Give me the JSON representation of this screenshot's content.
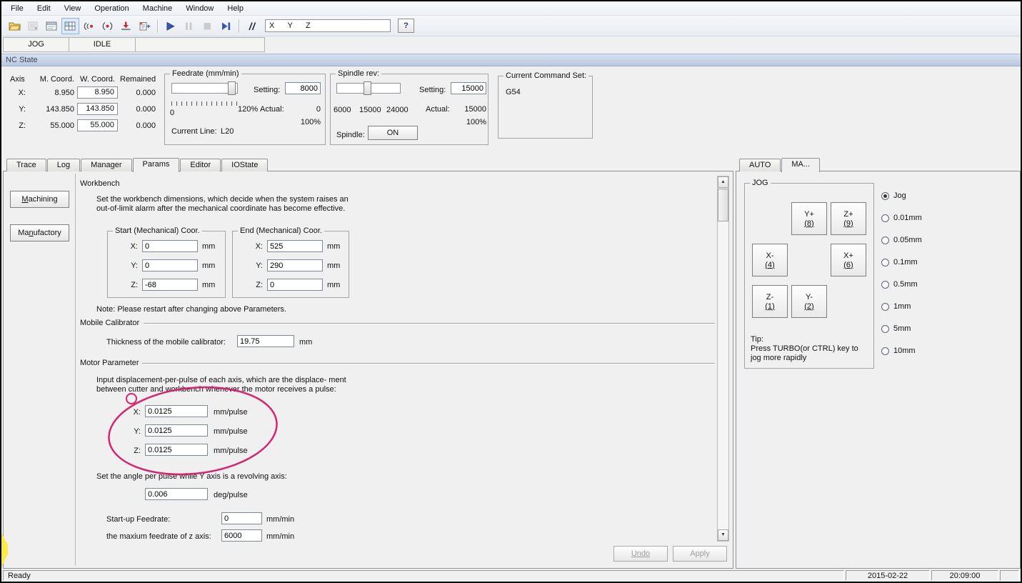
{
  "menubar": {
    "items": [
      "File",
      "Edit",
      "View",
      "Operation",
      "Machine",
      "Window",
      "Help"
    ]
  },
  "toolbar": {
    "icons": [
      "open-file",
      "simulate",
      "display-window",
      "view-switch",
      "trace-point",
      "trace-continuous",
      "tool-measure",
      "export",
      "start",
      "pause",
      "stop",
      "advanced-start",
      "handwheel-guide"
    ],
    "xyz_text": "X      Y      Z",
    "help_label": "?"
  },
  "mode_tabs": {
    "left": "JOG",
    "middle": "IDLE"
  },
  "nc_state": {
    "title": "NC State"
  },
  "status": {
    "axis_table": {
      "headers": [
        "Axis",
        "M. Coord.",
        "W. Coord.",
        "Remained"
      ],
      "rows": [
        {
          "axis": "X:",
          "m": "8.950",
          "w": "8.950",
          "r": "0.000"
        },
        {
          "axis": "Y:",
          "m": "143.850",
          "w": "143.850",
          "r": "0.000"
        },
        {
          "axis": "Z:",
          "m": "55.000",
          "w": "55.000",
          "r": "0.000"
        }
      ]
    },
    "feedrate": {
      "title": "Feedrate (mm/min)",
      "setting_label": "Setting:",
      "setting": "8000",
      "scale_min": "0",
      "scale_max": "120%",
      "actual_label": "Actual:",
      "actual": "0",
      "percent": "100%",
      "current_line_label": "Current Line:",
      "current_line": "L20"
    },
    "spindle": {
      "title": "Spindle rev:",
      "setting_label": "Setting:",
      "setting": "15000",
      "scale": [
        "6000",
        "15000",
        "24000"
      ],
      "actual_label": "Actual:",
      "actual": "15000",
      "percent": "100%",
      "spindle_label": "Spindle:",
      "on_label": "ON"
    },
    "command": {
      "title": "Current Command Set:",
      "value": "G54"
    }
  },
  "main_tabs": [
    "Trace",
    "Log",
    "Manager",
    "Params",
    "Editor",
    "IOState"
  ],
  "active_main_tab": "Params",
  "side_buttons": [
    {
      "pre": "",
      "u": "M",
      "post": "achining"
    },
    {
      "pre": "Ma",
      "u": "n",
      "post": "ufactory"
    }
  ],
  "params": {
    "workbench": {
      "title": "Workbench",
      "desc_line1": "Set the workbench dimensions, which decide when the system raises an",
      "desc_line2": "out-of-limit alarm after the mechanical coordinate has become effective.",
      "axis_labels": {
        "x": "X:",
        "y": "Y:",
        "z": "Z:"
      },
      "start": {
        "title": "Start (Mechanical) Coor.",
        "x": "0",
        "y": "0",
        "z": "-68",
        "unit": "mm"
      },
      "end": {
        "title": "End (Mechanical) Coor.",
        "x": "525",
        "y": "290",
        "z": "0",
        "unit": "mm"
      },
      "note": "Note: Please restart after changing above Parameters."
    },
    "mobile": {
      "title": "Mobile Calibrator",
      "label": "Thickness of the mobile calibrator:",
      "value": "19.75",
      "unit": "mm"
    },
    "motor": {
      "title": "Motor Parameter",
      "desc_line1": "Input displacement-per-pulse of each axis, which are the displace- ment",
      "desc_line2": "between cutter and workbench whenever the motor receives a pulse:",
      "x": "0.0125",
      "y": "0.0125",
      "z": "0.0125",
      "unit": "mm/pulse",
      "angle_label": "Set the angle per pulse while Y axis is a revolving axis:",
      "angle_value": "0.006",
      "angle_unit": "deg/pulse",
      "startup_label": "Start-up Feedrate:",
      "startup_value": "0",
      "startup_unit": "mm/min",
      "maxz_label": "the maxium feedrate of z axis:",
      "maxz_value": "6000",
      "maxz_unit": "mm/min"
    },
    "undo_label": "Undo",
    "apply_label": "Apply"
  },
  "right_panel": {
    "tabs": [
      "AUTO",
      "MA..."
    ],
    "active_tab": "MA...",
    "group_title": "JOG",
    "jog_buttons": [
      {
        "axis": "Y+",
        "key": "(8)"
      },
      {
        "axis": "Z+",
        "key": "(9)"
      },
      {
        "axis": "X-",
        "key": "(4)"
      },
      {
        "axis": "X+",
        "key": "(6)"
      },
      {
        "axis": "Z-",
        "key": "(1)"
      },
      {
        "axis": "Y-",
        "key": "(2)"
      }
    ],
    "tip_title": "Tip:",
    "tip_line1": "Press TURBO(or CTRL) key to",
    "tip_line2": "jog more rapidly",
    "step_options": [
      "Jog",
      "0.01mm",
      "0.05mm",
      "0.1mm",
      "0.5mm",
      "1mm",
      "5mm",
      "10mm"
    ],
    "selected_step": "Jog"
  },
  "statusbar": {
    "ready": "Ready",
    "date": "2015-02-22",
    "time": "20:09:00"
  },
  "colors": {
    "annotation": "#d6246e",
    "nc_state_bar": "#b7c8e1",
    "accent_blue": "#3a57a8"
  }
}
